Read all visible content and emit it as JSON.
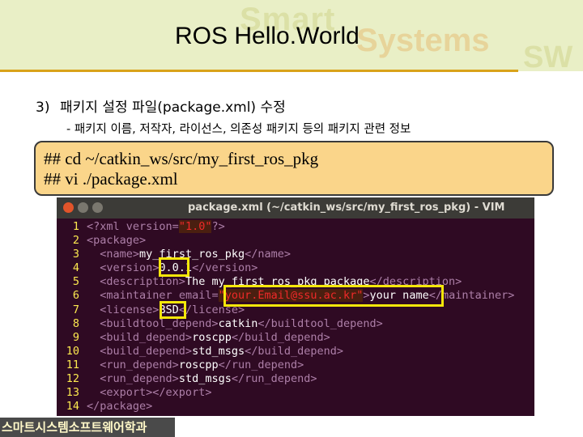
{
  "slide": {
    "watermark": {
      "smart": "Smart",
      "systems": "Systems",
      "sw": "SW"
    },
    "title": "ROS Hello.World",
    "step": {
      "number": "3)",
      "text": "패키지 설정 파일(package.xml) 수정"
    },
    "sub_text": "- 패키지 이름, 저작자, 라이선스, 의존성 패키지 등의 패키지 관련 정보",
    "commands": [
      "## cd ~/catkin_ws/src/my_first_ros_pkg",
      "## vi ./package.xml"
    ],
    "footer": "스마트시스템소프트웨어학과"
  },
  "terminal": {
    "title": "package.xml (~/catkin_ws/src/my_first_ros_pkg) - VIM",
    "lines": [
      {
        "n": "1",
        "indent": "",
        "t1": "<?xml ",
        "a1": "version=",
        "s1": "\"1.0\"",
        "t2": "?>",
        "txt": "",
        "t3": ""
      },
      {
        "n": "2",
        "indent": "",
        "t1": "<package>",
        "a1": "",
        "s1": "",
        "t2": "",
        "txt": "",
        "t3": ""
      },
      {
        "n": "3",
        "indent": "  ",
        "t1": "<name>",
        "a1": "",
        "s1": "",
        "t2": "",
        "txt": "my_first_ros_pkg",
        "t3": "</name>"
      },
      {
        "n": "4",
        "indent": "  ",
        "t1": "<version>",
        "a1": "",
        "s1": "",
        "t2": "",
        "txt": "0.0.1",
        "t3": "</version>"
      },
      {
        "n": "5",
        "indent": "  ",
        "t1": "<description>",
        "a1": "",
        "s1": "",
        "t2": "",
        "txt": "The my_first_ros_pkg package",
        "t3": "</description>"
      },
      {
        "n": "6",
        "indent": "  ",
        "t1": "<maintainer ",
        "a1": "email=",
        "s1": "\"your.Email@ssu.ac.kr\"",
        "t2": ">",
        "txt": "your name",
        "t3": "</maintainer>"
      },
      {
        "n": "7",
        "indent": "  ",
        "t1": "<license>",
        "a1": "",
        "s1": "",
        "t2": "",
        "txt": "BSD",
        "t3": "</license>"
      },
      {
        "n": "8",
        "indent": "  ",
        "t1": "<buildtool_depend>",
        "a1": "",
        "s1": "",
        "t2": "",
        "txt": "catkin",
        "t3": "</buildtool_depend>"
      },
      {
        "n": "9",
        "indent": "  ",
        "t1": "<build_depend>",
        "a1": "",
        "s1": "",
        "t2": "",
        "txt": "roscpp",
        "t3": "</build_depend>"
      },
      {
        "n": "10",
        "indent": "  ",
        "t1": "<build_depend>",
        "a1": "",
        "s1": "",
        "t2": "",
        "txt": "std_msgs",
        "t3": "</build_depend>"
      },
      {
        "n": "11",
        "indent": "  ",
        "t1": "<run_depend>",
        "a1": "",
        "s1": "",
        "t2": "",
        "txt": "roscpp",
        "t3": "</run_depend>"
      },
      {
        "n": "12",
        "indent": "  ",
        "t1": "<run_depend>",
        "a1": "",
        "s1": "",
        "t2": "",
        "txt": "std_msgs",
        "t3": "</run_depend>"
      },
      {
        "n": "13",
        "indent": "  ",
        "t1": "<export>",
        "a1": "",
        "s1": "",
        "t2": "",
        "txt": "",
        "t3": "</export>"
      },
      {
        "n": "14",
        "indent": "",
        "t1": "</package>",
        "a1": "",
        "s1": "",
        "t2": "",
        "txt": "",
        "t3": ""
      }
    ],
    "highlights": [
      "version-value",
      "license-value",
      "maintainer-email-and-name"
    ],
    "colors": {
      "background": "#2f0a23",
      "line_numbers": "#fce94f",
      "tags": "#ad7fa8",
      "strings": "#ef2929",
      "highlight_box": "#f5e70a"
    }
  }
}
